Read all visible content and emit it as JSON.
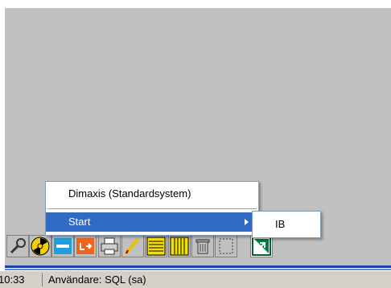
{
  "menu": {
    "items": [
      {
        "label": "Dimaxis (Standardsystem)"
      },
      {
        "label": "Start"
      }
    ]
  },
  "submenu": {
    "items": [
      {
        "label": "IB"
      }
    ]
  },
  "toolbar": {
    "icons": [
      "wrench-icon",
      "radiation-icon",
      "save-icon",
      "export-icon",
      "printer-icon",
      "edit-icon",
      "form-icon",
      "columns-icon",
      "trash-icon",
      "select-icon",
      "exit-icon"
    ]
  },
  "status": {
    "time": "10:33",
    "user": "Användare: SQL (sa)"
  },
  "colors": {
    "selection": "#316ac5",
    "rule": "#1c3fa8"
  }
}
